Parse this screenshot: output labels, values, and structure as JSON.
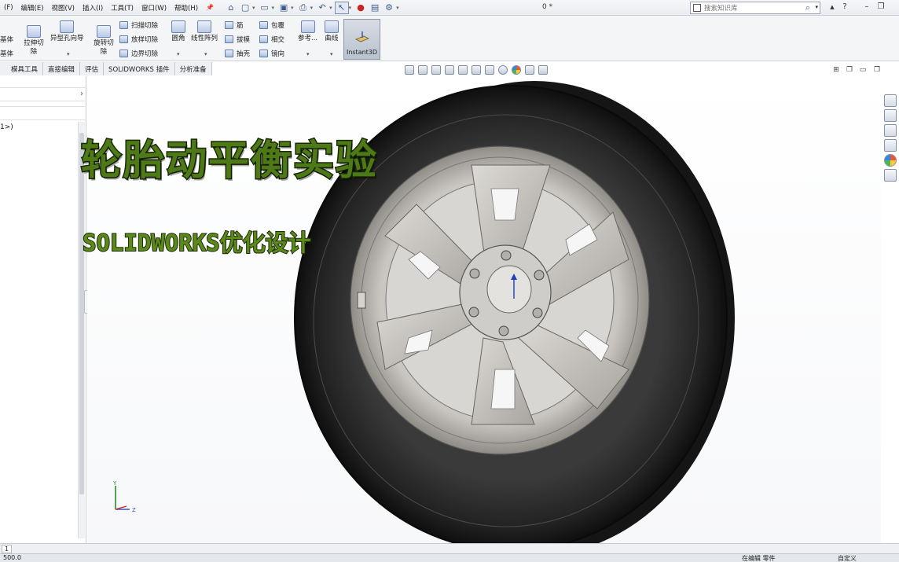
{
  "menubar": {
    "items": [
      "(F)",
      "编辑(E)",
      "视图(V)",
      "插入(I)",
      "工具(T)",
      "窗口(W)",
      "帮助(H)"
    ],
    "pin": "📌",
    "title_center": "0 *",
    "search_placeholder": "搜索知识库",
    "controls": [
      "▲",
      "?",
      "–",
      "❐"
    ]
  },
  "ribbon": {
    "left_labels": [
      "基体",
      "基体"
    ],
    "extrude_cut": "拉伸切除",
    "hole_wizard": "异型孔向导",
    "revolve_cut": "旋转切除",
    "swept_cut": "扫描切除",
    "loft_cut": "放样切除",
    "boundary_cut": "边界切除",
    "fillet": "圆角",
    "linear_pattern": "线性阵列",
    "rib": "筋",
    "draft": "拔模",
    "shell": "抽壳",
    "wrap": "包覆",
    "intersect": "相交",
    "mirror": "镜向",
    "reference": "参考...",
    "curves": "曲线",
    "instant3d": "Instant3D"
  },
  "tabs": [
    "模具工具",
    "直接编辑",
    "评估",
    "SOLIDWORKS 插件",
    "分析准备"
  ],
  "left_panel": {
    "feature_text": "1>)"
  },
  "overlay": {
    "title": "轮胎动平衡实验",
    "subtitle": "SOLIDWORKS优化设计"
  },
  "triad": {
    "y": "Y",
    "z": "Z"
  },
  "bottom": {
    "tab": "1",
    "status_left": "500.0",
    "status_mid": "在编辑 零件",
    "status_right": "自定义"
  },
  "colors": {
    "title_green": "#4d7a17",
    "tire_dark": "#1b1b1b",
    "rim_silver": "#c9c6c1"
  }
}
